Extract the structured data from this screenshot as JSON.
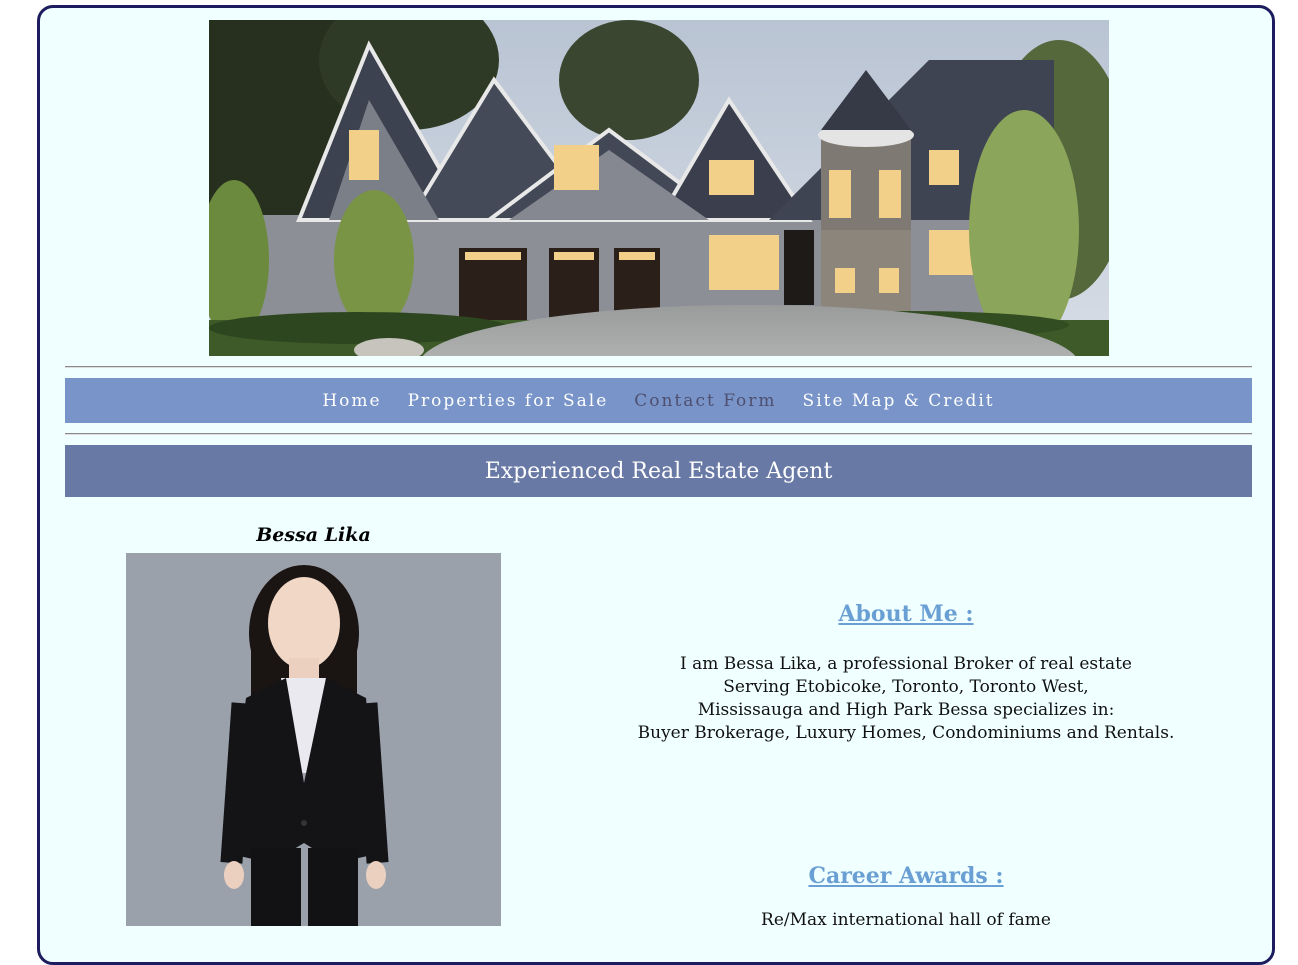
{
  "nav": {
    "items": [
      {
        "label": "Home"
      },
      {
        "label": "Properties for Sale"
      },
      {
        "label": "Contact Form"
      },
      {
        "label": "Site Map & Credit"
      }
    ]
  },
  "banner": {
    "title": "Experienced Real Estate Agent"
  },
  "agent": {
    "name": "Bessa Lika"
  },
  "about": {
    "heading": "About Me :",
    "lines": [
      "I am Bessa Lika, a professional Broker of real estate",
      "Serving Etobicoke, Toronto, Toronto West,",
      "Mississauga and High Park Bessa specializes in:",
      "Buyer Brokerage, Luxury Homes, Condominiums and Rentals."
    ]
  },
  "awards": {
    "heading": "Career Awards :",
    "first_item": "Re/Max international hall of fame"
  },
  "colors": {
    "page_bg": "#f0ffff",
    "frame_border": "#1c1c5e",
    "nav_bg": "#7894c8",
    "banner_bg": "#6879a6",
    "heading_link": "#6a9fd4"
  }
}
